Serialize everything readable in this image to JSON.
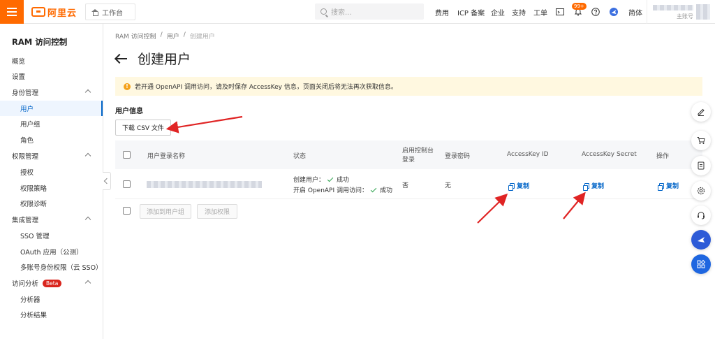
{
  "topbar": {
    "brand": "阿里云",
    "workbench": "工作台",
    "search_placeholder": "搜索...",
    "nav": [
      "费用",
      "ICP 备案",
      "企业",
      "支持",
      "工单"
    ],
    "notification_count": "99+",
    "language": "简体",
    "account_sub": "主账号",
    "brand_color": "#ff6a00"
  },
  "sidebar": {
    "title": "RAM 访问控制",
    "items": [
      {
        "label": "概览",
        "level": 1
      },
      {
        "label": "设置",
        "level": 1
      },
      {
        "label": "身份管理",
        "level": 1,
        "expandable": true
      },
      {
        "label": "用户",
        "level": 2,
        "active": true
      },
      {
        "label": "用户组",
        "level": 2
      },
      {
        "label": "角色",
        "level": 2
      },
      {
        "label": "权限管理",
        "level": 1,
        "expandable": true
      },
      {
        "label": "授权",
        "level": 2
      },
      {
        "label": "权限策略",
        "level": 2
      },
      {
        "label": "权限诊断",
        "level": 2
      },
      {
        "label": "集成管理",
        "level": 1,
        "expandable": true
      },
      {
        "label": "SSO 管理",
        "level": 2
      },
      {
        "label": "OAuth 应用（公测）",
        "level": 2
      },
      {
        "label": "多账号身份权限（云 SSO）",
        "level": 2
      },
      {
        "label": "访问分析",
        "level": 1,
        "expandable": true,
        "badge": "Beta"
      },
      {
        "label": "分析器",
        "level": 2
      },
      {
        "label": "分析结果",
        "level": 2
      }
    ]
  },
  "breadcrumb": [
    "RAM 访问控制",
    "用户",
    "创建用户"
  ],
  "page_title": "创建用户",
  "notice": "若开通 OpenAPI 调用访问，请及时保存 AccessKey 信息，页面关闭后将无法再次获取信息。",
  "section_title": "用户信息",
  "download_button": "下载 CSV 文件",
  "table": {
    "headers": {
      "login_name": "用户登录名称",
      "status": "状态",
      "console_login": "启用控制台登录",
      "password": "登录密码",
      "ak_id": "AccessKey ID",
      "ak_secret": "AccessKey Secret",
      "actions": "操作"
    },
    "row": {
      "status_line1_label": "创建用户：",
      "status_line1_value": "成功",
      "status_line2_label": "开启 OpenAPI 调用访问：",
      "status_line2_value": "成功",
      "console_login": "否",
      "password": "无",
      "ak_id_copy": "复制",
      "ak_secret_copy": "复制",
      "action_copy": "复制"
    },
    "footer_buttons": {
      "add_to_group": "添加到用户组",
      "add_permission": "添加权限"
    }
  }
}
